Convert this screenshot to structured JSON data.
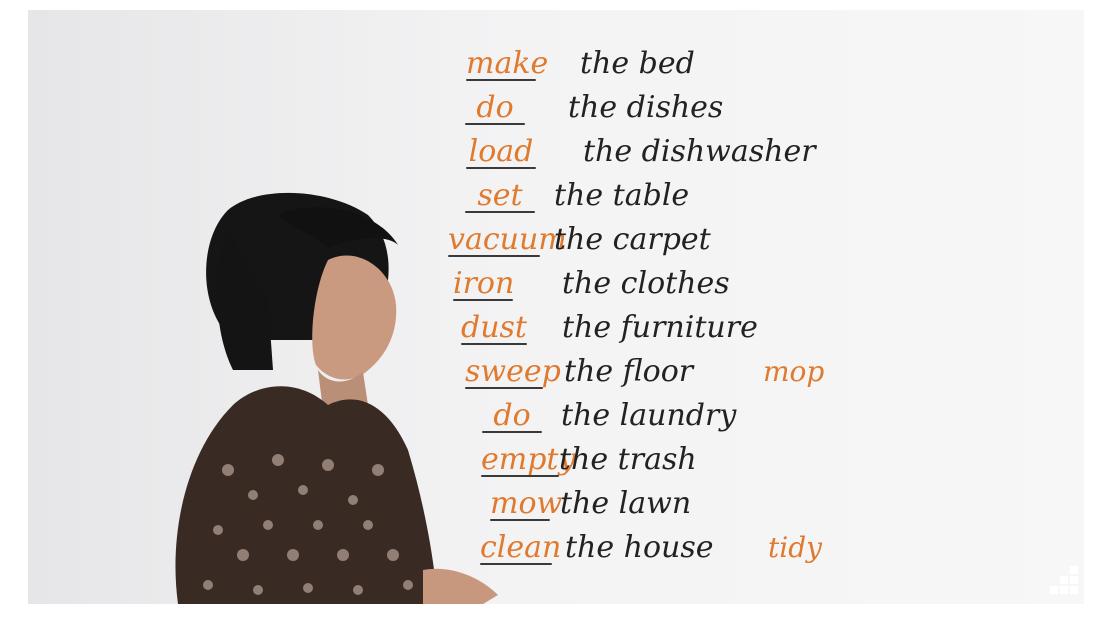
{
  "video": {
    "rows": [
      {
        "verb": "make",
        "rest": "the bed"
      },
      {
        "verb": "do",
        "rest": "the dishes"
      },
      {
        "verb": "load",
        "rest": "the dishwasher"
      },
      {
        "verb": "set",
        "rest": "the table"
      },
      {
        "verb": "vacuum",
        "rest": "the carpet"
      },
      {
        "verb": "iron",
        "rest": "the clothes"
      },
      {
        "verb": "dust",
        "rest": "the furniture"
      },
      {
        "verb": "sweep",
        "rest": "the floor",
        "extra": "mop"
      },
      {
        "verb": "do",
        "rest": "the laundry"
      },
      {
        "verb": "empty",
        "rest": "the trash"
      },
      {
        "verb": "mow",
        "rest": "the lawn"
      },
      {
        "verb": "clean",
        "rest": "the house",
        "extra": "tidy"
      }
    ],
    "controls": {
      "fullscreen_icon": "fullscreen-icon"
    },
    "colors": {
      "accent": "#e07a2f",
      "ink": "#222222"
    }
  }
}
